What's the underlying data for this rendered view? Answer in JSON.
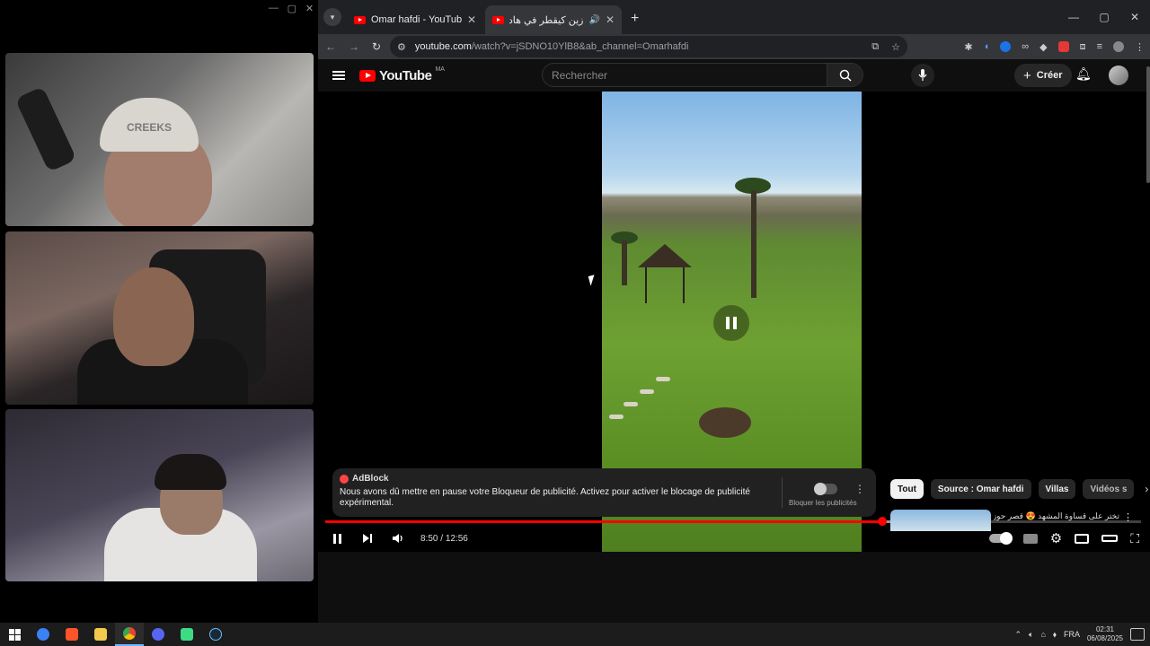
{
  "webcam_panel": {
    "title_controls": [
      "—",
      "▢",
      "✕"
    ]
  },
  "browser": {
    "tabs": [
      {
        "title": "Omar hafdi - YouTube",
        "active": false
      },
      {
        "title": "زين كيقطر في هاد القصر الـ",
        "active": true,
        "audio": "🔊"
      }
    ],
    "tab_close": "✕",
    "new_tab": "+",
    "window_controls": [
      "—",
      "▢",
      "✕"
    ],
    "nav": {
      "back": "←",
      "forward": "→",
      "reload": "↻"
    },
    "address": {
      "host": "youtube.com",
      "path": "/watch?v=jSDNO10YlB8&ab_channel=Omarhafdi"
    }
  },
  "youtube": {
    "logo_word": "YouTube",
    "country_code": "MA",
    "search_placeholder": "Rechercher",
    "create_label": "Créer",
    "player": {
      "current_time": "8:50",
      "duration": "12:56",
      "progress_fraction": 0.683,
      "buffered_fraction": 0.737
    },
    "adblock": {
      "brand": "AdBlock",
      "message": "Nous avons dû mettre en pause votre Bloqueur de publicité. Activez pour activer le blocage de publicité expérimental.",
      "toggle_label": "Bloquer les publicités"
    },
    "chips": [
      "Tout",
      "Source : Omar hafdi",
      "Villas",
      "Vidéos s"
    ],
    "recommendation": {
      "title": "تختر على قساوة المشهد 😍 قصر حوزة للبيع"
    }
  },
  "taskbar": {
    "language": "FRA",
    "time": "02:31",
    "date": "06/08/2025"
  },
  "colors": {
    "accent_red": "#ff0000",
    "bg": "#0f0f0f"
  }
}
